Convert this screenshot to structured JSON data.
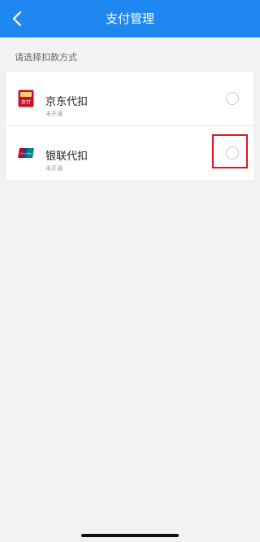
{
  "header": {
    "title": "支付管理",
    "back_icon": "chevron-left-icon",
    "background": "#1e88f0"
  },
  "section_label": "请选择扣款方式",
  "payment_methods": [
    {
      "name": "京东代扣",
      "status": "未开通",
      "icon": "jd-pay-icon",
      "icon_text": "京付",
      "selected": false
    },
    {
      "name": "银联代扣",
      "status": "未开通",
      "icon": "unionpay-icon",
      "icon_text": "UnionPay",
      "selected": false
    }
  ],
  "colors": {
    "highlight": "#e8141c",
    "jd_red": "#c8102e",
    "union_red": "#d0021b",
    "union_blue": "#0a4b9a",
    "union_green": "#00847f"
  }
}
